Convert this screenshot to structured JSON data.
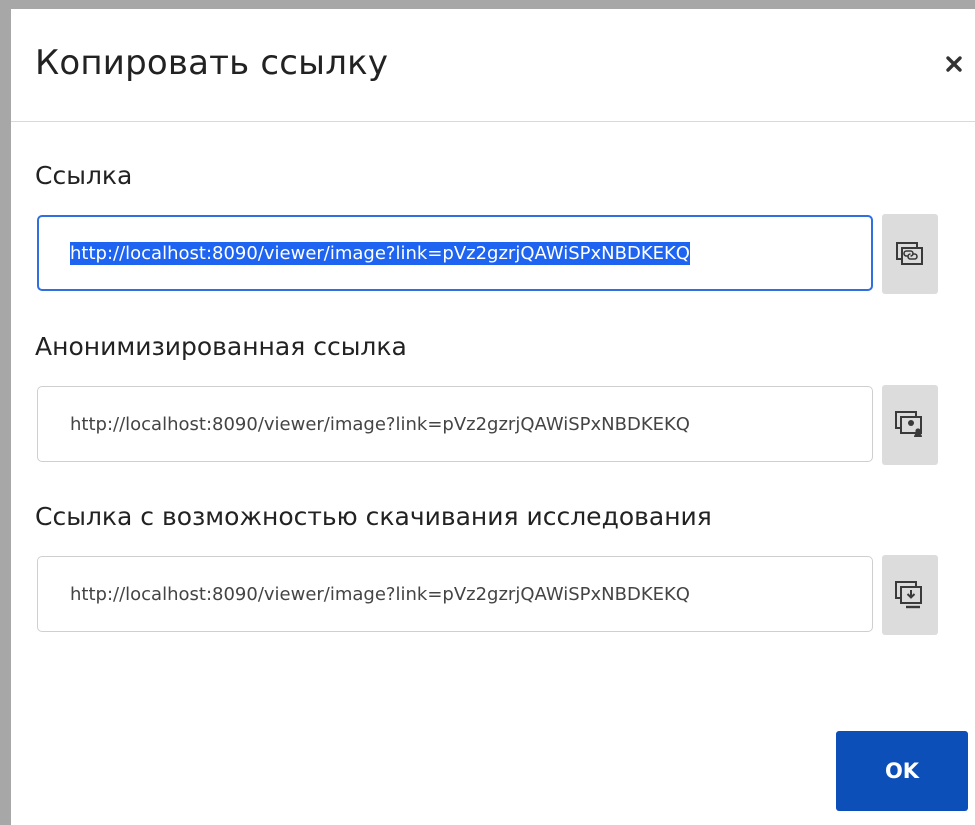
{
  "dialog": {
    "title": "Копировать ссылку",
    "close_icon": "close-icon"
  },
  "fields": [
    {
      "label": "Ссылка",
      "value": "http://localhost:8090/viewer/image?link=pVz2gzrjQAWiSPxNBDKEKQ",
      "selected": true,
      "button_icon": "copy-link-icon"
    },
    {
      "label": "Анонимизированная ссылка",
      "value": "http://localhost:8090/viewer/image?link=pVz2gzrjQAWiSPxNBDKEKQ",
      "selected": false,
      "button_icon": "copy-anonymous-link-icon"
    },
    {
      "label": "Ссылка с возможностью скачивания исследования",
      "value": "http://localhost:8090/viewer/image?link=pVz2gzrjQAWiSPxNBDKEKQ",
      "selected": false,
      "button_icon": "copy-download-link-icon"
    }
  ],
  "footer": {
    "ok_label": "OK"
  },
  "colors": {
    "primary": "#0d4fb8",
    "focus_border": "#2f6fe0",
    "selection": "#1e64f0",
    "button_bg": "#dcdcdc"
  }
}
